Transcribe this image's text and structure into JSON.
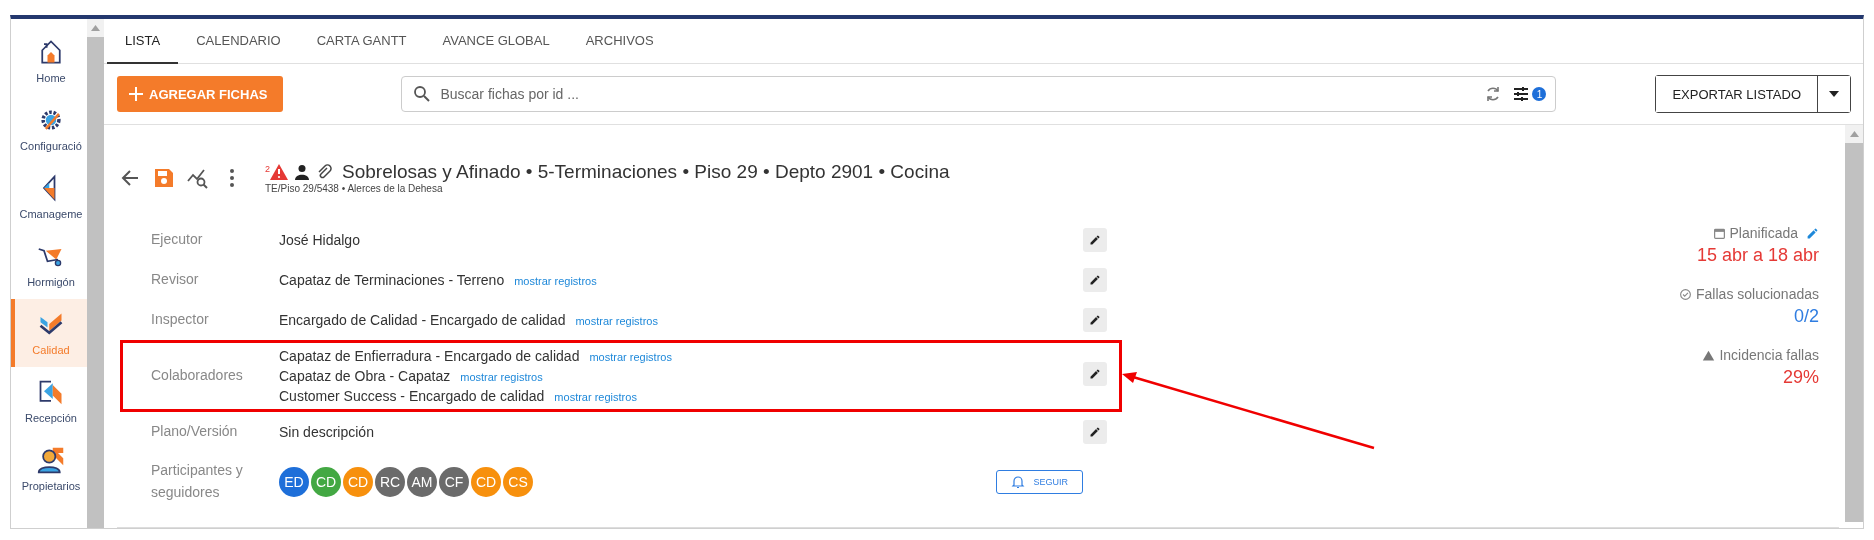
{
  "sidebar": {
    "items": [
      {
        "label": "Home",
        "selected": false
      },
      {
        "label": "Configuració",
        "selected": false
      },
      {
        "label": "Cmanageme",
        "selected": false
      },
      {
        "label": "Hormigón",
        "selected": false
      },
      {
        "label": "Calidad",
        "selected": true
      },
      {
        "label": "Recepción",
        "selected": false
      },
      {
        "label": "Propietarios",
        "selected": false
      }
    ]
  },
  "tabs": [
    {
      "label": "LISTA",
      "selected": true
    },
    {
      "label": "CALENDARIO",
      "selected": false
    },
    {
      "label": "CARTA GANTT",
      "selected": false
    },
    {
      "label": "AVANCE GLOBAL",
      "selected": false
    },
    {
      "label": "ARCHIVOS",
      "selected": false
    }
  ],
  "toolbar": {
    "add_button": "AGREGAR FICHAS",
    "search": {
      "placeholder": "Buscar fichas por id ..."
    },
    "filter_badge": "1",
    "export_button": "EXPORTAR LISTADO"
  },
  "record": {
    "alert_count": "2",
    "title": "Sobrelosas y Afinado • 5-Terminaciones • Piso 29 • Depto 2901 • Cocina",
    "subtitle": "TE/Piso 29/5438 • Alerces de la Dehesa",
    "fields": [
      {
        "label": "Ejecutor",
        "kind": "text",
        "editable": true,
        "highlighted": false,
        "entries": [
          {
            "value": "José Hidalgo"
          }
        ]
      },
      {
        "label": "Revisor",
        "kind": "text",
        "editable": true,
        "highlighted": false,
        "entries": [
          {
            "value": "Capataz de Terminaciones - Terreno",
            "link": "mostrar registros"
          }
        ]
      },
      {
        "label": "Inspector",
        "kind": "text",
        "editable": true,
        "highlighted": false,
        "entries": [
          {
            "value": "Encargado de Calidad - Encargado de calidad",
            "link": "mostrar registros"
          }
        ]
      },
      {
        "label": "Colaboradores",
        "kind": "text",
        "editable": true,
        "highlighted": true,
        "entries": [
          {
            "value": "Capataz de Enfierradura - Encargado de calidad",
            "link": "mostrar registros"
          },
          {
            "value": "Capataz de Obra - Capataz",
            "link": "mostrar registros"
          },
          {
            "value": "Customer Success - Encargado de calidad",
            "link": "mostrar registros"
          }
        ]
      },
      {
        "label": "Plano/Versión",
        "kind": "text",
        "editable": true,
        "highlighted": false,
        "entries": [
          {
            "value": "Sin descripción"
          }
        ]
      },
      {
        "label": "Participantes y seguidores",
        "kind": "avatars",
        "editable": false,
        "highlighted": false,
        "follow_button": "SEGUIR",
        "avatars": [
          {
            "initials": "ED",
            "color": "#1e6fd9"
          },
          {
            "initials": "CD",
            "color": "#43a843"
          },
          {
            "initials": "CD",
            "color": "#f7900d"
          },
          {
            "initials": "RC",
            "color": "#6b6b6b"
          },
          {
            "initials": "AM",
            "color": "#6b6b6b"
          },
          {
            "initials": "CF",
            "color": "#6b6b6b"
          },
          {
            "initials": "CD",
            "color": "#f7900d"
          },
          {
            "initials": "CS",
            "color": "#f7900d"
          }
        ]
      }
    ]
  },
  "stats": [
    {
      "kind": "calendar",
      "label": "Planificada",
      "value": "15 abr a 18 abr",
      "color": "#e53935",
      "editable": true
    },
    {
      "kind": "check",
      "label": "Fallas solucionadas",
      "value": "0/2",
      "color": "#2f7de1",
      "editable": false
    },
    {
      "kind": "warning",
      "label": "Incidencia fallas",
      "value": "29%",
      "color": "#e53935",
      "editable": false
    }
  ]
}
